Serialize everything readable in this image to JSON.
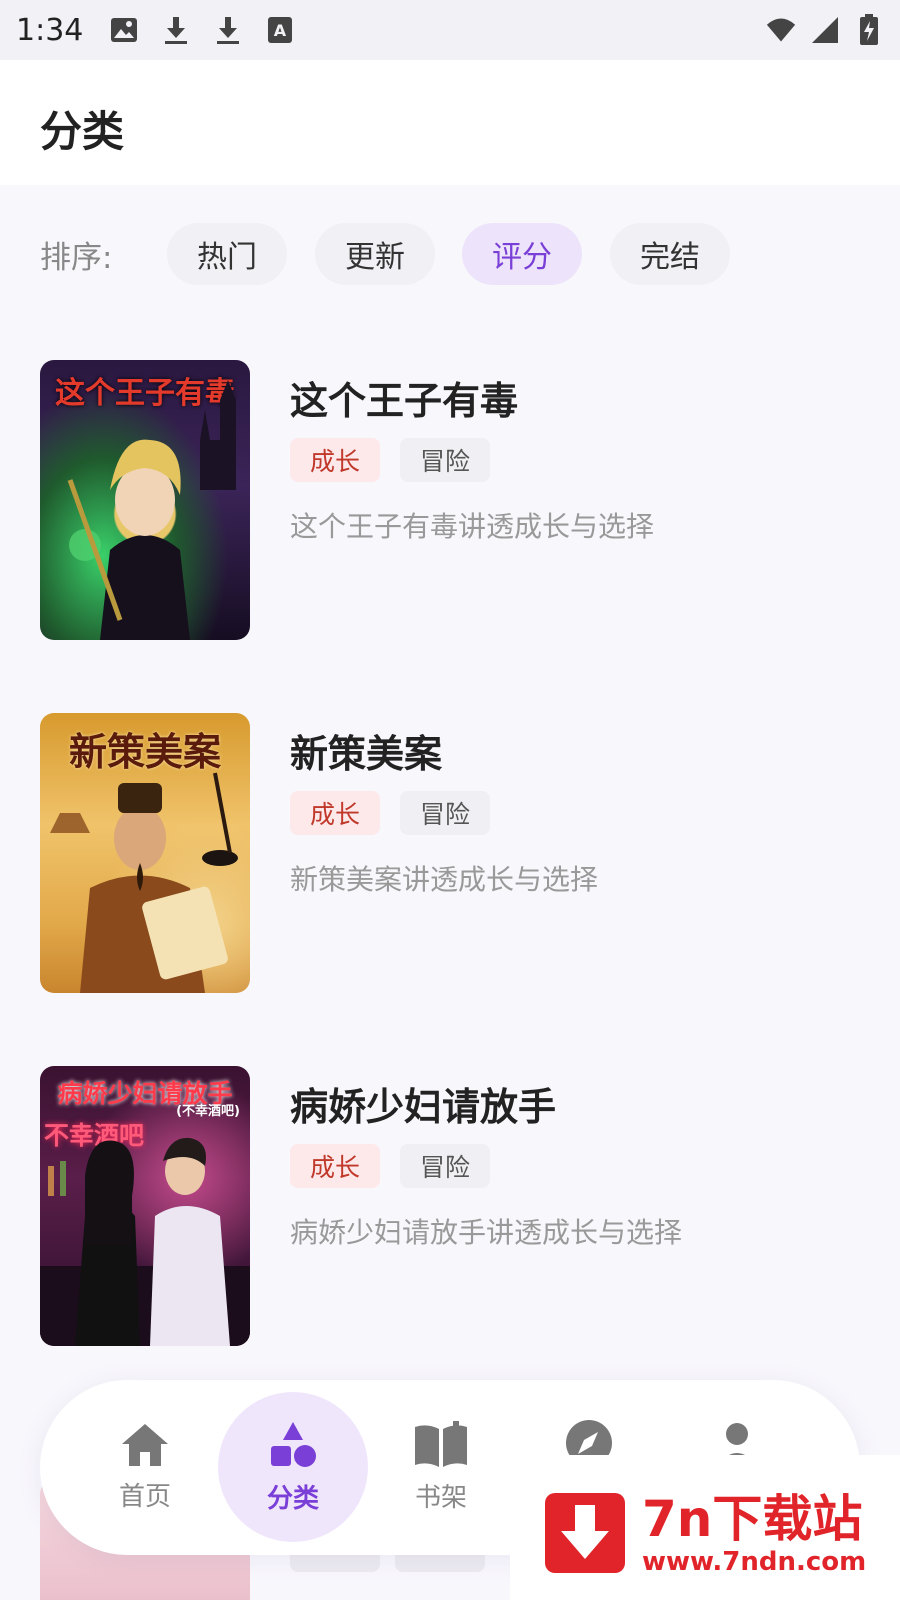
{
  "status_bar": {
    "time": "1:34",
    "left_icons": [
      "image-icon",
      "download-icon",
      "download-icon",
      "font-icon"
    ],
    "right_icons": [
      "wifi-icon",
      "signal-icon",
      "battery-charging-icon"
    ]
  },
  "header": {
    "title": "分类"
  },
  "sort": {
    "label": "排序:",
    "options": [
      {
        "label": "热门",
        "active": false
      },
      {
        "label": "更新",
        "active": false
      },
      {
        "label": "评分",
        "active": true
      },
      {
        "label": "完结",
        "active": false
      }
    ]
  },
  "books": [
    {
      "title": "这个王子有毒",
      "cover_text": "这个王子有毒",
      "tags": [
        "成长",
        "冒险"
      ],
      "description": "这个王子有毒讲透成长与选择"
    },
    {
      "title": "新策美案",
      "cover_text": "新策美案",
      "tags": [
        "成长",
        "冒险"
      ],
      "description": "新策美案讲透成长与选择"
    },
    {
      "title": "病娇少妇请放手",
      "cover_text": "病娇少妇请放手",
      "cover_subtext": "(不幸酒吧)",
      "cover_sign": "不幸酒吧",
      "tags": [
        "成长",
        "冒险"
      ],
      "description": "病娇少妇请放手讲透成长与选择"
    }
  ],
  "bottom_nav": [
    {
      "label": "首页",
      "icon": "home-icon",
      "active": false
    },
    {
      "label": "分类",
      "icon": "category-icon",
      "active": true
    },
    {
      "label": "书架",
      "icon": "bookshelf-icon",
      "active": false
    },
    {
      "label": "",
      "icon": "compass-icon",
      "active": false
    },
    {
      "label": "",
      "icon": "profile-icon",
      "active": false
    }
  ],
  "watermark": {
    "name": "7n下载站",
    "url": "www.7ndn.com"
  },
  "colors": {
    "accent": "#7a3fd6",
    "accent_bg": "#ede4fb",
    "tag_growth_bg": "#fde8ea",
    "tag_growth_text": "#c0392b",
    "watermark_red": "#e1242a"
  }
}
